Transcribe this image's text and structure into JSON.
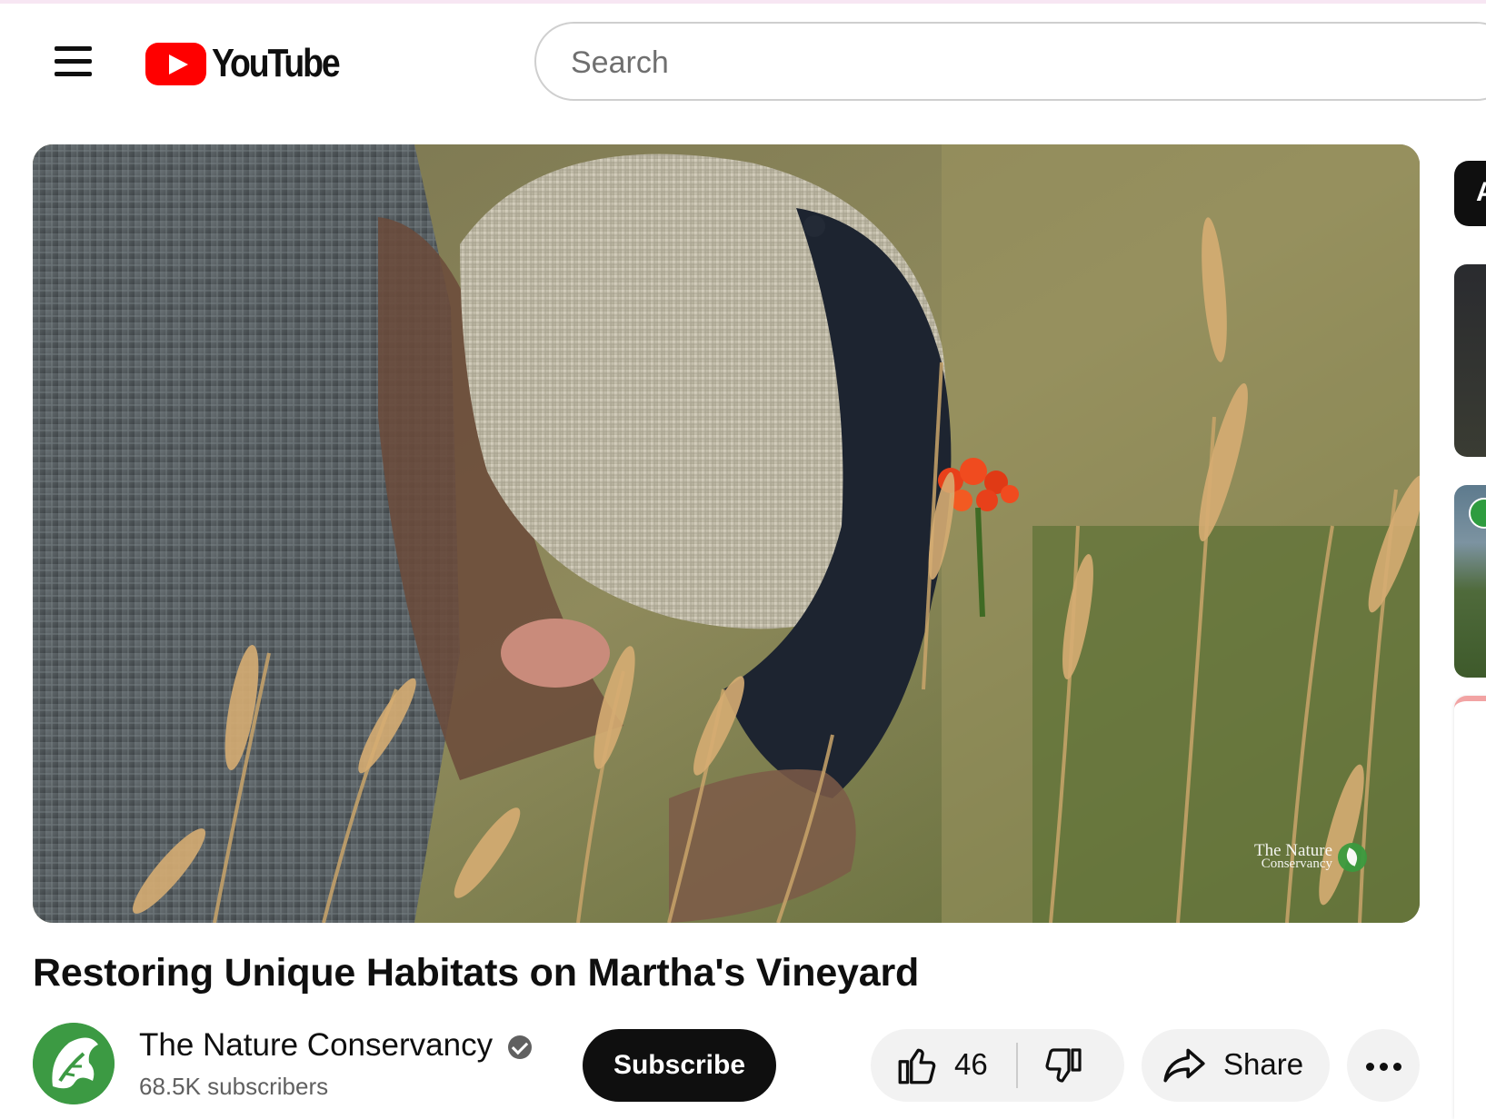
{
  "header": {
    "logo_text": "YouTube",
    "search_placeholder": "Search"
  },
  "video": {
    "title": "Restoring Unique Habitats on Martha's Vineyard",
    "watermark_line1": "The Nature",
    "watermark_line2": "Conservancy"
  },
  "channel": {
    "name": "The Nature Conservancy",
    "subscribers": "68.5K subscribers",
    "verified": true,
    "avatar_icon": "nature-conservancy-leaf-logo"
  },
  "actions": {
    "subscribe_label": "Subscribe",
    "like_count": "46",
    "share_label": "Share",
    "like_icon": "thumbs-up-icon",
    "dislike_icon": "thumbs-down-icon",
    "share_icon": "share-arrow-icon",
    "more_icon": "more-horizontal-icon"
  },
  "sidebar_partial": {
    "chip_label_visible": "A"
  },
  "colors": {
    "brand_red": "#ff0000",
    "text_primary": "#0f0f0f",
    "text_secondary": "#606060",
    "pill_bg": "#f2f2f2",
    "subscribe_bg": "#0f0f0f",
    "conservancy_green": "#3c9a43"
  }
}
